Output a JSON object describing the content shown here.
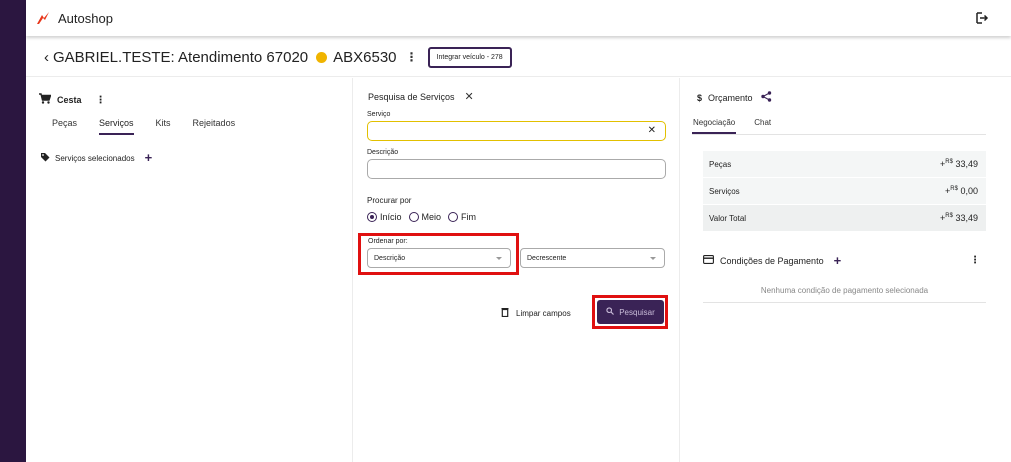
{
  "app": {
    "title": "Autoshop"
  },
  "header": {
    "back": "‹",
    "title": "GABRIEL.TESTE: Atendimento 67020",
    "plate": "ABX6530",
    "kebab": "⋮",
    "integrate_label": "Integrar veículo - 278"
  },
  "left": {
    "cesta_label": "Cesta",
    "kebab": "⋮",
    "tabs": [
      {
        "label": "Peças"
      },
      {
        "label": "Serviços"
      },
      {
        "label": "Kits"
      },
      {
        "label": "Rejeitados"
      }
    ],
    "selected_label": "Serviços selecionados",
    "plus": "+"
  },
  "search": {
    "title": "Pesquisa de Serviços",
    "close": "✕",
    "service_label": "Serviço",
    "service_value": "",
    "clear": "✕",
    "description_label": "Descrição",
    "description_value": "",
    "procurar_label": "Procurar por",
    "radios": [
      {
        "label": "Início",
        "checked": true
      },
      {
        "label": "Meio",
        "checked": false
      },
      {
        "label": "Fim",
        "checked": false
      }
    ],
    "order_label": "Ordenar por:",
    "order_value": "Descrição",
    "direction_value": "Decrescente",
    "clear_fields_label": "Limpar campos",
    "search_button_label": "Pesquisar"
  },
  "budget": {
    "title": "Orçamento",
    "dollar": "$",
    "tabs": [
      {
        "label": "Negociação"
      },
      {
        "label": "Chat"
      }
    ],
    "rows": [
      {
        "label": "Peças",
        "prefix": "+",
        "currency": "R$",
        "amount": "33,49"
      },
      {
        "label": "Serviços",
        "prefix": "+",
        "currency": "R$",
        "amount": "0,00"
      },
      {
        "label": "Valor Total",
        "prefix": "+",
        "currency": "R$",
        "amount": "33,49"
      }
    ],
    "payment_label": "Condições de Pagamento",
    "plus": "+",
    "kebab": "⋮",
    "empty_payment": "Nenhuma condição de pagamento selecionada"
  },
  "colors": {
    "sidebar": "#2b1640",
    "accent": "#3a2356",
    "status_dot": "#f0b400",
    "highlight": "#e01010",
    "focus_border": "#e2c000"
  }
}
